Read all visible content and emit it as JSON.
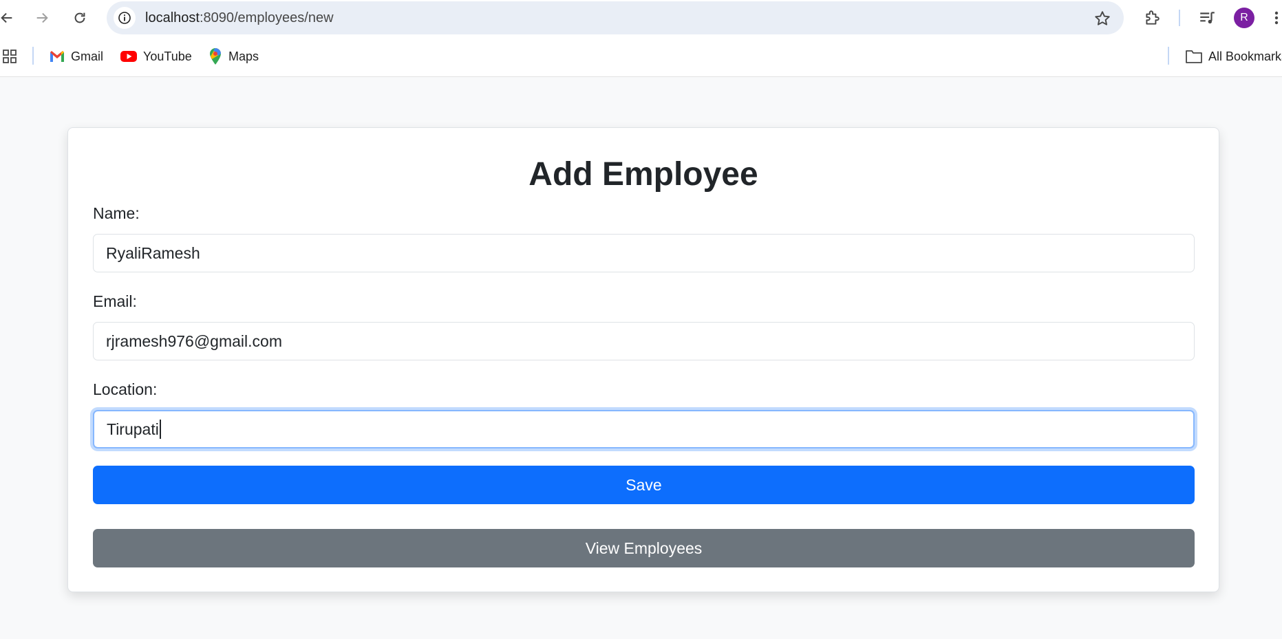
{
  "browser": {
    "url_host": "localhost",
    "url_path": ":8090/employees/new",
    "avatar_letter": "R",
    "bookmarks": [
      "Gmail",
      "YouTube",
      "Maps"
    ],
    "all_bookmarks_label": "All Bookmarks"
  },
  "form": {
    "title": "Add Employee",
    "name_label": "Name:",
    "name_value": "RyaliRamesh",
    "email_label": "Email:",
    "email_value": "rjramesh976@gmail.com",
    "location_label": "Location:",
    "location_value": "Tirupati",
    "save_label": "Save",
    "view_label": "View Employees"
  },
  "colors": {
    "primary": "#0d6efd",
    "secondary": "#6c757d",
    "avatar": "#7b1fa2"
  }
}
